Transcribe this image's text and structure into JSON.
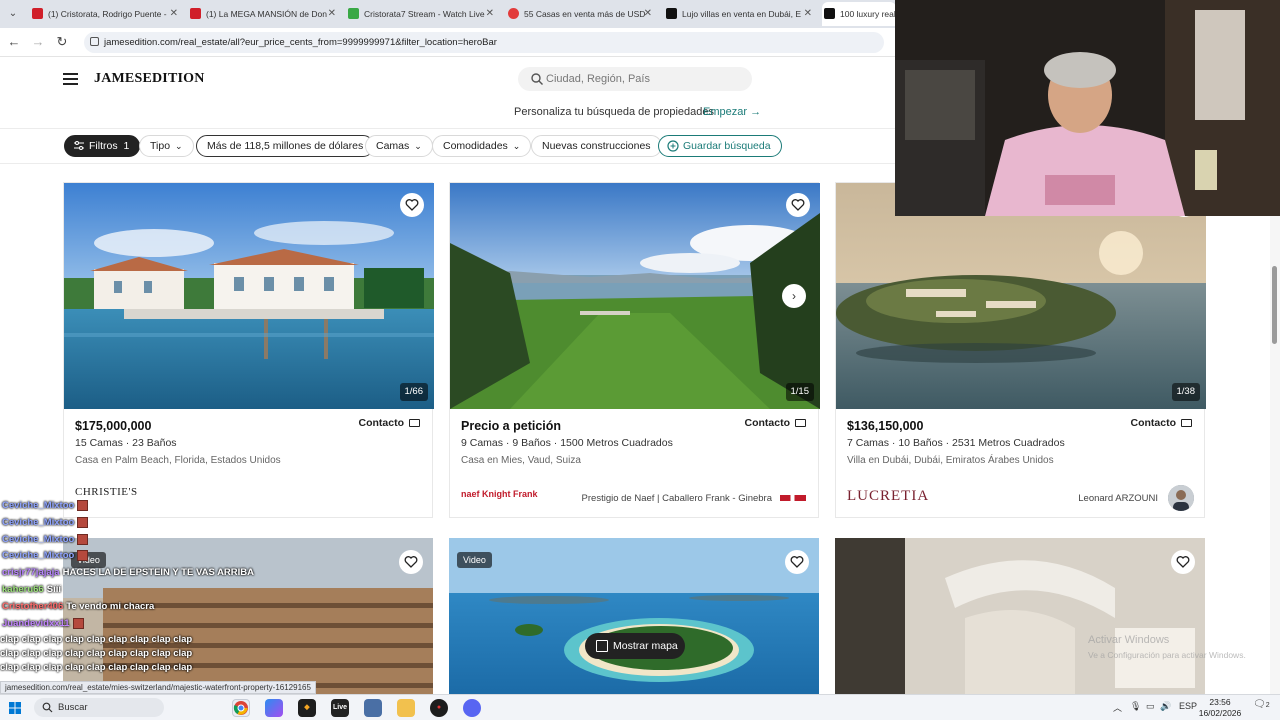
{
  "browser": {
    "tabs": [
      {
        "title": "(1) Cristorata, Rodrigo Puente -",
        "color": "#d01f2a"
      },
      {
        "title": "(1) La MEGA MANSIÓN de Don",
        "color": "#d01f2a"
      },
      {
        "title": "Cristorata7 Stream - Watch Live",
        "color": "#39a845"
      },
      {
        "title": "55 Casas en venta más de USD",
        "color": "#e23b3b"
      },
      {
        "title": "Lujo villas en venta en Dubái, E",
        "color": "#111111"
      },
      {
        "title": "100 luxury real",
        "color": "#111111"
      }
    ],
    "url": "jamesedition.com/real_estate/all?eur_price_cents_from=9999999971&filter_location=heroBar"
  },
  "header": {
    "logo": "JAMESEDITION",
    "search_placeholder": "Ciudad, Región, País",
    "personalize_text": "Personaliza tu búsqueda de propiedades",
    "start_link": "Empezar →"
  },
  "filters": {
    "filters_label": "Filtros",
    "filters_count": "1",
    "tipo": "Tipo",
    "price": "Más de 118,5 millones de dólares",
    "camas": "Camas",
    "comodidades": "Comodidades",
    "nuevas": "Nuevas construcciones",
    "guardar": "Guardar búsqueda"
  },
  "listings": [
    {
      "price": "$175,000,000",
      "contact": "Contacto",
      "specs": "15 Camas · 23 Baños",
      "location": "Casa en Palm Beach, Florida, Estados Unidos",
      "agency": "CHRISTIE'S",
      "agent": "",
      "counter": "1/66"
    },
    {
      "price": "Precio a petición",
      "contact": "Contacto",
      "specs": "9 Camas · 9 Baños · 1500 Metros Cuadrados",
      "location": "Casa en Mies, Vaud, Suiza",
      "agency": "naef Knight Frank",
      "agent": "Prestigio de Naef | Caballero Frank - Ginebra",
      "counter": "1/15"
    },
    {
      "price": "$136,150,000",
      "contact": "Contacto",
      "specs": "7 Camas · 10 Baños · 2531 Metros Cuadrados",
      "location": "Villa en Dubái, Dubái, Emiratos Árabes Unidos",
      "agency": "LUCRETIA",
      "agent": "Leonard ARZOUNI",
      "counter": "1/38"
    }
  ],
  "second_row": {
    "video_label": "Video",
    "map_button": "Mostrar mapa"
  },
  "chat": {
    "messages": [
      {
        "user": "Ceviche_Mixtoo",
        "text": "",
        "color": "#8fa4ff"
      },
      {
        "user": "Ceviche_Mixtoo",
        "text": "",
        "color": "#8fa4ff"
      },
      {
        "user": "Ceviche_Mixtoo",
        "text": "",
        "color": "#8fa4ff"
      },
      {
        "user": "Ceviche_Mixtoo",
        "text": "",
        "color": "#8fa4ff"
      },
      {
        "user": "crisjr77jajaja",
        "text": "HACES LA DE EPSTEIN Y TE VAS ARRIBA",
        "color": "#b884ff"
      },
      {
        "user": "kaheru66",
        "text": "Sííí",
        "color": "#9be07a"
      },
      {
        "user": "Cristofher406",
        "text": "Te vendo mi chacra",
        "color": "#ff6b6b"
      },
      {
        "user": "Juandevidxx11",
        "text": "",
        "color": "#c084fc"
      }
    ],
    "clap_line": "clap clap clap clap clap clap clap clap clap"
  },
  "status_link": "jamesedition.com/real_estate/mies-switzerland/majestic-waterfront-property-16129165",
  "windows_watermark": {
    "title": "Activar Windows",
    "subtitle": "Ve a Configuración para activar Windows."
  },
  "taskbar": {
    "search": "Buscar",
    "live_app": "Live",
    "lang": "ESP",
    "time": "23:56",
    "date": "16/02/2026",
    "notifications": "2"
  }
}
